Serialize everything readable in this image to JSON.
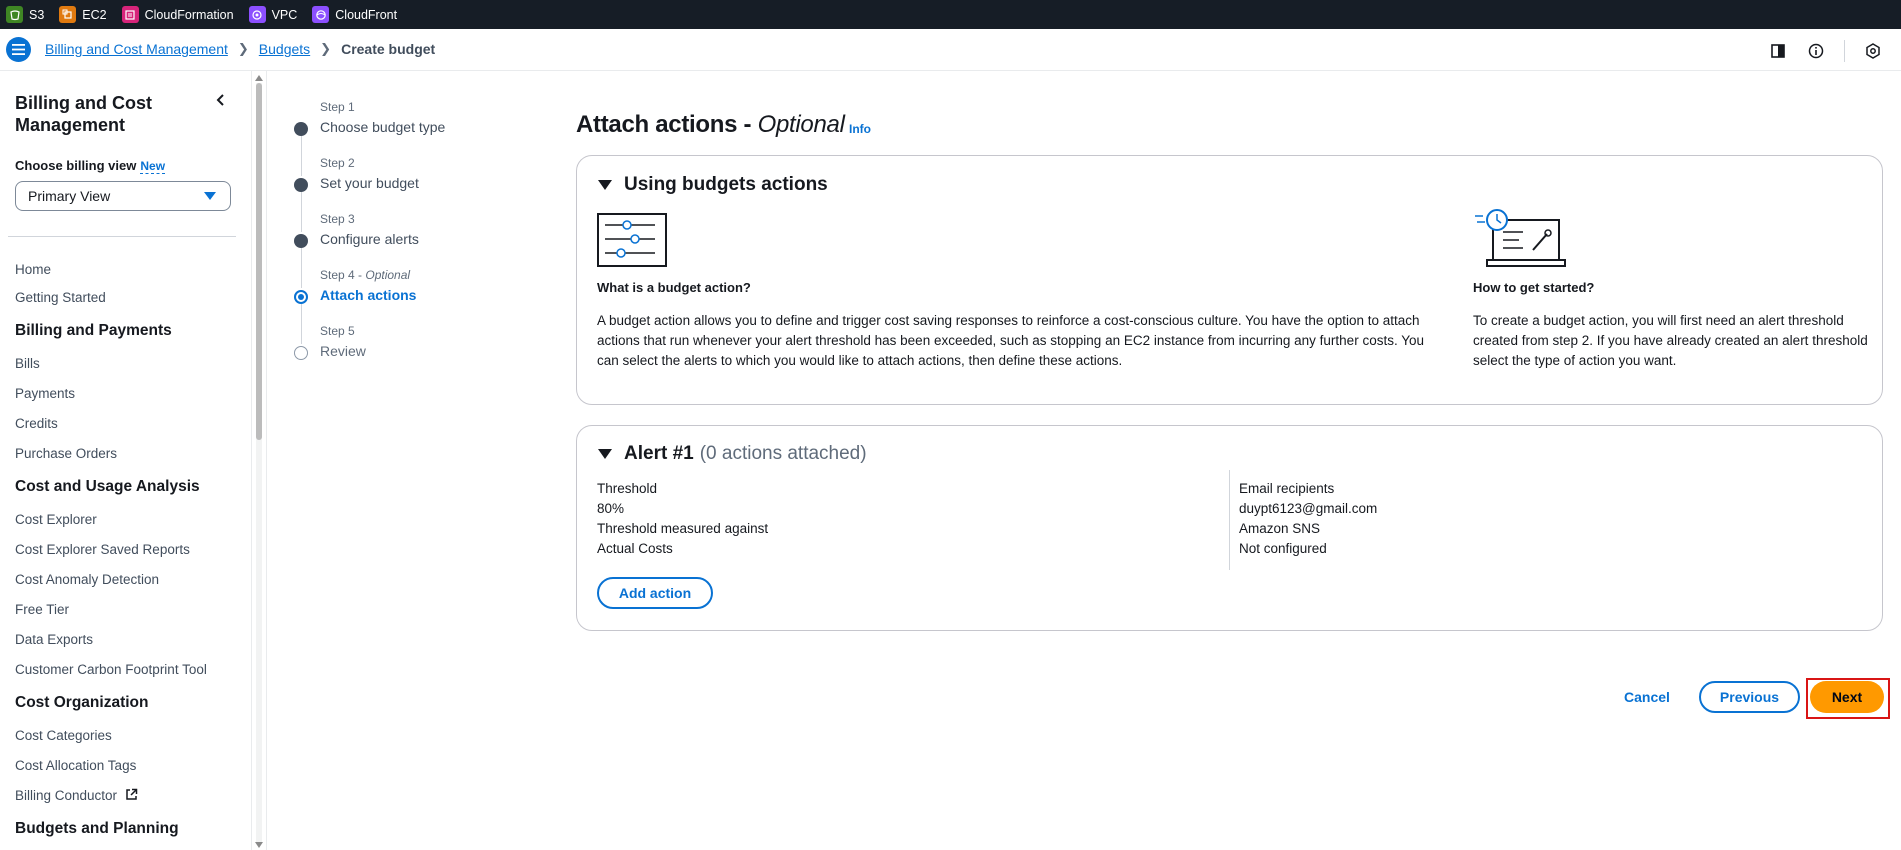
{
  "services": [
    {
      "label": "S3",
      "color": "#3f8624",
      "icon": "s3-icon"
    },
    {
      "label": "EC2",
      "color": "#e07a10",
      "icon": "ec2-icon"
    },
    {
      "label": "CloudFormation",
      "color": "#d6247a",
      "icon": "cloudformation-icon"
    },
    {
      "label": "VPC",
      "color": "#8c4fff",
      "icon": "vpc-icon"
    },
    {
      "label": "CloudFront",
      "color": "#8c4fff",
      "icon": "cloudfront-icon"
    }
  ],
  "breadcrumb": {
    "items": [
      "Billing and Cost Management",
      "Budgets"
    ],
    "current": "Create budget"
  },
  "sidebar": {
    "title": "Billing and Cost Management",
    "billing_view_label": "Choose billing view",
    "new_badge": "New",
    "billing_view_value": "Primary View",
    "items": {
      "home": "Home",
      "getting_started": "Getting Started",
      "billing_payments": "Billing and Payments",
      "bills": "Bills",
      "payments": "Payments",
      "credits": "Credits",
      "purchase_orders": "Purchase Orders",
      "cost_usage": "Cost and Usage Analysis",
      "cost_explorer": "Cost Explorer",
      "cost_explorer_saved": "Cost Explorer Saved Reports",
      "cost_anomaly": "Cost Anomaly Detection",
      "free_tier": "Free Tier",
      "data_exports": "Data Exports",
      "carbon": "Customer Carbon Footprint Tool",
      "cost_org": "Cost Organization",
      "cost_categories": "Cost Categories",
      "cost_alloc_tags": "Cost Allocation Tags",
      "billing_conductor": "Billing Conductor",
      "budgets_planning": "Budgets and Planning"
    }
  },
  "steps": [
    {
      "label": "Step 1",
      "name": "Choose budget type",
      "state": "done"
    },
    {
      "label": "Step 2",
      "name": "Set your budget",
      "state": "done"
    },
    {
      "label": "Step 3",
      "name": "Configure alerts",
      "state": "done"
    },
    {
      "label": "Step 4",
      "label_suffix": "Optional",
      "name": "Attach actions",
      "state": "active"
    },
    {
      "label": "Step 5",
      "name": "Review",
      "state": "future"
    }
  ],
  "page": {
    "title": "Attach actions",
    "title_sep": " - ",
    "title_optional": "Optional",
    "info": "Info"
  },
  "budget_actions_panel": {
    "heading": "Using budgets actions",
    "left_heading": "What is a budget action?",
    "left_text": "A budget action allows you to define and trigger cost saving responses to reinforce a cost-conscious culture. You have the option to attach actions that run whenever your alert threshold has been exceeded, such as stopping an EC2 instance from incurring any further costs. You can select the alerts to which you would like to attach actions, then define these actions.",
    "right_heading": "How to get started?",
    "right_text": "To create a budget action, you will first need an alert threshold created from step 2. If you have already created an alert threshold select the type of action you want."
  },
  "alert_panel": {
    "heading": "Alert #1",
    "sub": "(0 actions attached)",
    "threshold_label": "Threshold",
    "threshold_value": "80%",
    "measured_label": "Threshold measured against",
    "measured_value": "Actual Costs",
    "email_label": "Email recipients",
    "email_value": "duypt6123@gmail.com",
    "sns_label": "Amazon SNS",
    "sns_value": "Not configured",
    "add_action": "Add action"
  },
  "footer": {
    "cancel": "Cancel",
    "previous": "Previous",
    "next": "Next"
  }
}
